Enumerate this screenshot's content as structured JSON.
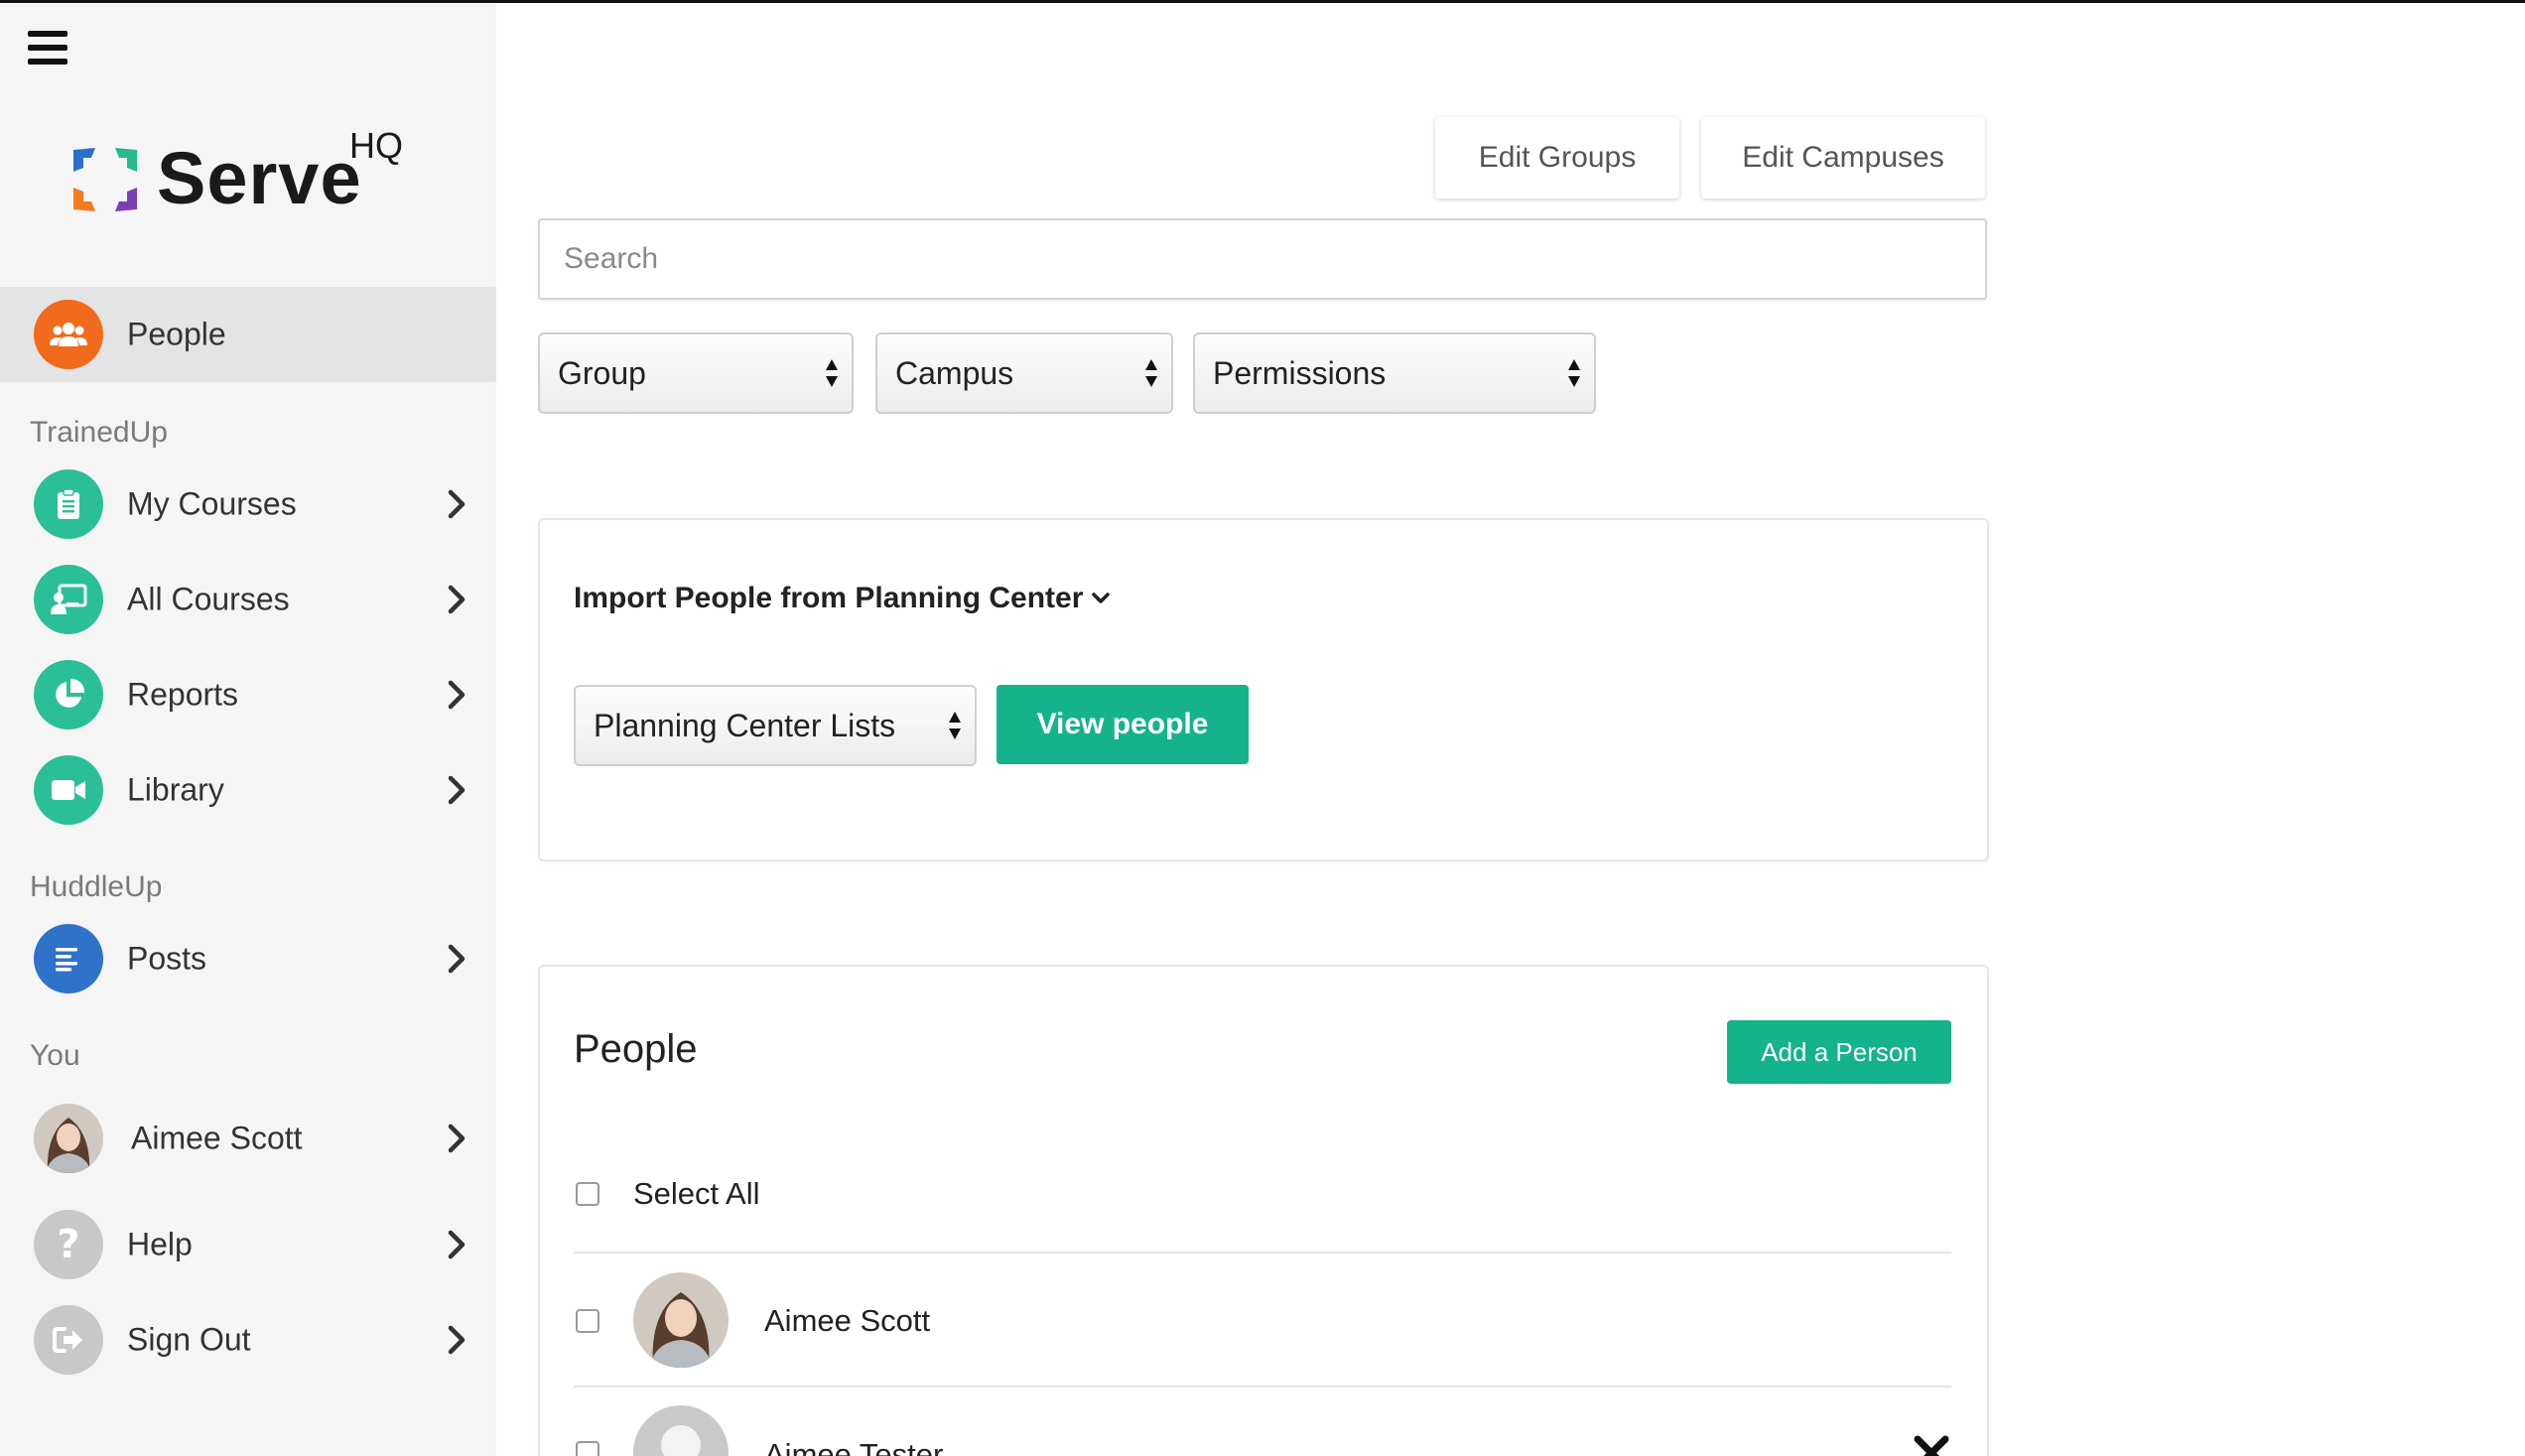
{
  "sidebar": {
    "menu_icon": "hamburger-icon",
    "logo": {
      "word": "Serve",
      "superscript": "HQ"
    },
    "active_item": {
      "label": "People",
      "icon": "people-icon",
      "color": "#f26a1b"
    },
    "sections": [
      {
        "title": "TrainedUp",
        "items": [
          {
            "label": "My Courses",
            "icon": "clipboard-icon",
            "color": "#2bbf97"
          },
          {
            "label": "All Courses",
            "icon": "presentation-icon",
            "color": "#2bbf97"
          },
          {
            "label": "Reports",
            "icon": "pie-chart-icon",
            "color": "#2bbf97"
          },
          {
            "label": "Library",
            "icon": "video-camera-icon",
            "color": "#2bbf97"
          }
        ]
      },
      {
        "title": "HuddleUp",
        "items": [
          {
            "label": "Posts",
            "icon": "align-left-icon",
            "color": "#2f72c9"
          }
        ]
      },
      {
        "title": "You",
        "items": [
          {
            "label": "Aimee Scott",
            "icon": "avatar"
          },
          {
            "label": "Help",
            "icon": "question-icon",
            "color": "#c8c8c8"
          },
          {
            "label": "Sign Out",
            "icon": "sign-out-icon",
            "color": "#c8c8c8"
          }
        ]
      }
    ]
  },
  "toolbar": {
    "edit_groups": "Edit Groups",
    "edit_campuses": "Edit Campuses"
  },
  "search": {
    "placeholder": "Search",
    "value": ""
  },
  "filters": {
    "group": "Group",
    "campus": "Campus",
    "permissions": "Permissions"
  },
  "import": {
    "title": "Import People from Planning Center",
    "select_value": "Planning Center Lists",
    "button": "View people"
  },
  "people": {
    "title": "People",
    "add_button": "Add a Person",
    "select_all": "Select All",
    "rows": [
      {
        "name": "Aimee Scott",
        "avatar": "photo"
      },
      {
        "name": "Aimee Tester",
        "avatar": "placeholder"
      }
    ]
  },
  "colors": {
    "accent_green": "#14b38b",
    "people_orange": "#f26a1b",
    "trainedup_teal": "#2bbf97",
    "huddleup_blue": "#2f72c9"
  }
}
